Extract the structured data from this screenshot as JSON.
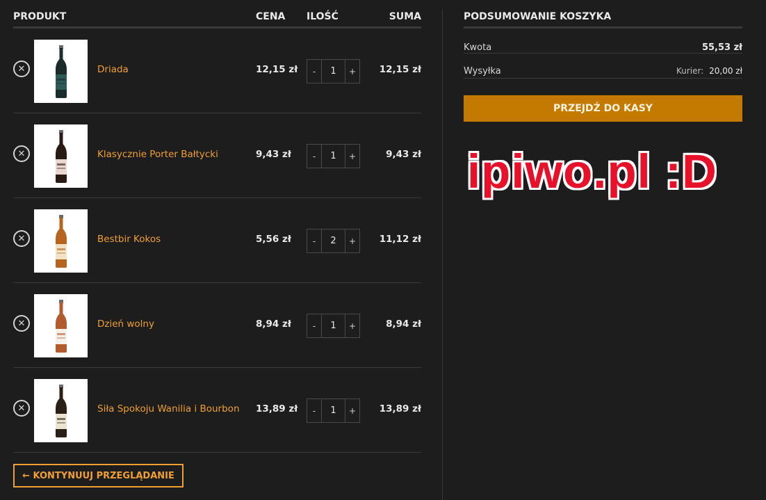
{
  "cart": {
    "headers": {
      "product": "PRODUKT",
      "price": "CENA",
      "quantity": "ILOŚĆ",
      "total": "SUMA"
    },
    "items": [
      {
        "name": "Driada",
        "price": "12,15 zł",
        "qty": "1",
        "total": "12,15 zł",
        "bottle_color": "#1c2b2c",
        "label_color": "#2d5a57"
      },
      {
        "name": "Klasycznie Porter Bałtycki",
        "price": "9,43 zł",
        "qty": "1",
        "total": "9,43 zł",
        "bottle_color": "#2a1a14",
        "label_color": "#e9d7cf"
      },
      {
        "name": "Bestbir Kokos",
        "price": "5,56 zł",
        "qty": "2",
        "total": "11,12 zł",
        "bottle_color": "#b5651d",
        "label_color": "#f2e3c4"
      },
      {
        "name": "Dzień wolny",
        "price": "8,94 zł",
        "qty": "1",
        "total": "8,94 zł",
        "bottle_color": "#b35b2c",
        "label_color": "#f4f1ea"
      },
      {
        "name": "Siła Spokoju Wanilia i Bourbon",
        "price": "13,89 zł",
        "qty": "1",
        "total": "13,89 zł",
        "bottle_color": "#2b2017",
        "label_color": "#ece4d3"
      }
    ],
    "remove_symbol": "✕",
    "minus": "-",
    "plus": "+",
    "continue_label": "← KONTYNUUJ PRZEGLĄDANIE"
  },
  "summary": {
    "title": "PODSUMOWANIE KOSZYKA",
    "amount_label": "Kwota",
    "amount_value": "55,53 zł",
    "shipping_label": "Wysyłka",
    "shipping_method": "Kurier:",
    "shipping_value": "20,00 zł",
    "checkout_label": "PRZEJDŹ DO KASY"
  },
  "overlay_text": "ipiwo.pl :D",
  "colors": {
    "accent": "#f0a030",
    "checkout_bg": "#c47a00",
    "overlay": "#e8112a",
    "background": "#1d1d1e"
  }
}
